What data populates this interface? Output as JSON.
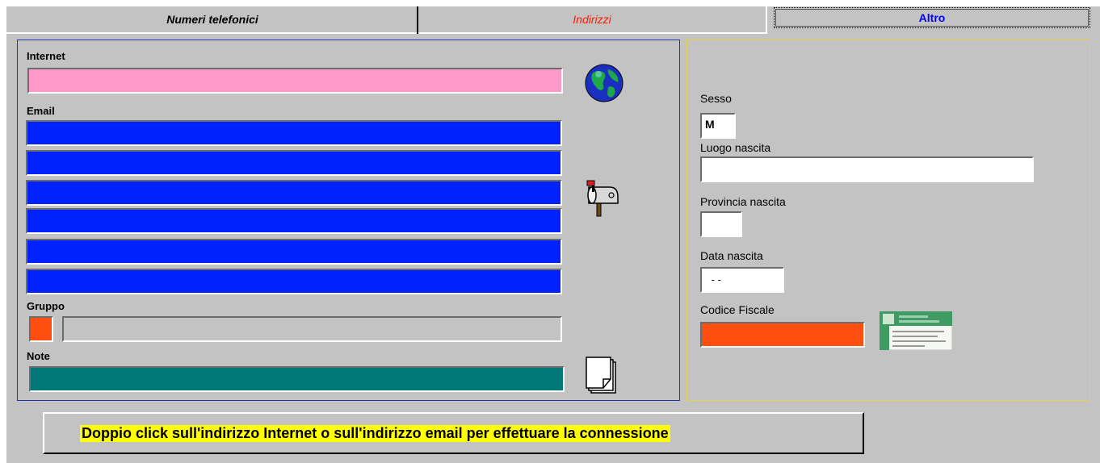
{
  "tabs": [
    {
      "label": "Numeri telefonici",
      "color": "#000000"
    },
    {
      "label": "Indirizzi",
      "color": "#ff1a00"
    },
    {
      "label": "Altro",
      "color": "#0000ff"
    }
  ],
  "left": {
    "internet_label": "Internet",
    "email_label": "Email",
    "gruppo_label": "Gruppo",
    "note_label": "Note",
    "colors": {
      "internet_field": "#ff99c8",
      "email_field": "#0022ff",
      "gruppo_swatch": "#ff4f10",
      "note_field": "#007878"
    }
  },
  "right": {
    "sesso_label": "Sesso",
    "sesso_value": "M",
    "luogo_label": "Luogo nascita",
    "provincia_label": "Provincia nascita",
    "data_label": "Data nascita",
    "data_value": " - -",
    "codice_label": "Codice Fiscale",
    "colors": {
      "codice_field": "#ff4f10"
    }
  },
  "icons": [
    "globe-icon",
    "mailbox-icon",
    "note-pages-icon",
    "tax-card-icon"
  ],
  "info_button": {
    "text": "Doppio click sull'indirizzo Internet o sull'indirizzo email per effettuare la connessione",
    "highlight": "#ffff00"
  }
}
